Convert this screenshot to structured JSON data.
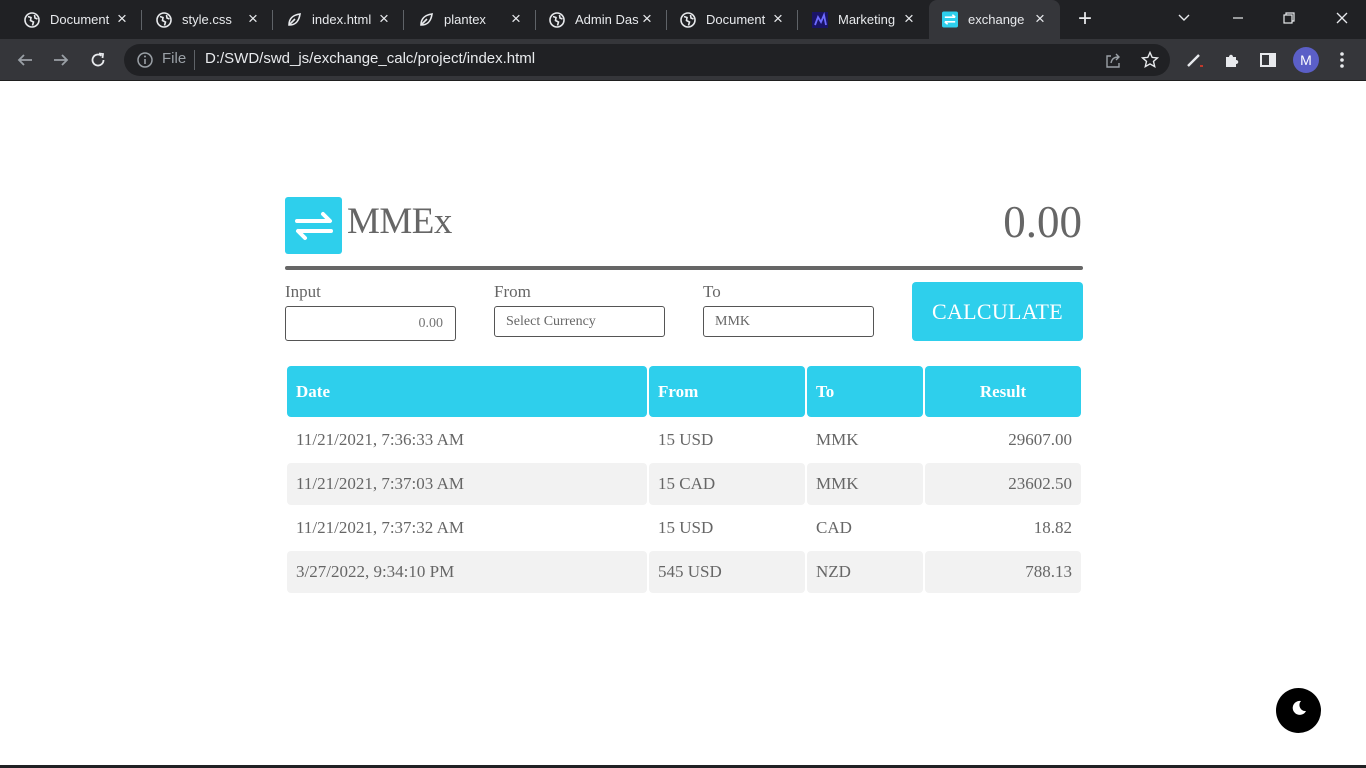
{
  "browser": {
    "tabs": [
      {
        "title": "Document",
        "icon": "globe-icon"
      },
      {
        "title": "style.css",
        "icon": "globe-icon"
      },
      {
        "title": "index.html",
        "icon": "leaf-icon"
      },
      {
        "title": "plantex",
        "icon": "leaf-icon"
      },
      {
        "title": "Admin Das",
        "icon": "globe-icon"
      },
      {
        "title": "Document",
        "icon": "globe-icon"
      },
      {
        "title": "Marketing",
        "icon": "marketing-icon"
      },
      {
        "title": "exchange c",
        "icon": "exchange-icon",
        "active": true
      }
    ],
    "file_label": "File",
    "url": "D:/SWD/swd_js/exchange_calc/project/index.html",
    "profile_initial": "M"
  },
  "app": {
    "brand": "MMEx",
    "result": "0.00",
    "accent_color": "#2ecfec",
    "form": {
      "input_label": "Input",
      "input_placeholder": "0.00",
      "from_label": "From",
      "from_value": "Select Currency",
      "to_label": "To",
      "to_value": "MMK",
      "calculate_label": "CALCULATE"
    },
    "history": {
      "columns": [
        "Date",
        "From",
        "To",
        "Result"
      ],
      "rows": [
        {
          "date": "11/21/2021, 7:36:33 AM",
          "from": "15 USD",
          "to": "MMK",
          "result": "29607.00"
        },
        {
          "date": "11/21/2021, 7:37:03 AM",
          "from": "15 CAD",
          "to": "MMK",
          "result": "23602.50"
        },
        {
          "date": "11/21/2021, 7:37:32 AM",
          "from": "15 USD",
          "to": "CAD",
          "result": "18.82"
        },
        {
          "date": "3/27/2022, 9:34:10 PM",
          "from": "545 USD",
          "to": "NZD",
          "result": "788.13"
        }
      ]
    }
  }
}
